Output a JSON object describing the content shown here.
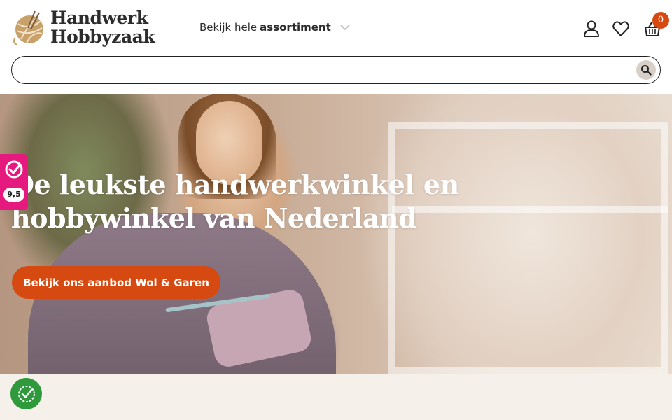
{
  "header": {
    "logo_line1": "Handwerk",
    "logo_line2": "Hobbyzaak",
    "assortment_prefix": "Bekijk hele",
    "assortment_bold": "assortiment",
    "cart_count": "0",
    "icons": [
      "account-icon",
      "heart-icon",
      "basket-icon",
      "chevron-down-icon"
    ]
  },
  "search": {
    "value": "",
    "placeholder": ""
  },
  "hero": {
    "title": "De leukste handwerkwinkel en hobbywinkel van Nederland",
    "cta_label": "Bekijk ons aanbod Wol & Garen"
  },
  "rating_widget": {
    "score": "9,5"
  },
  "colors": {
    "accent": "#d64a12",
    "rating_pink": "#e6197e",
    "cookie_green": "#2f9a3b",
    "footer_bg": "#f6f0ea"
  }
}
